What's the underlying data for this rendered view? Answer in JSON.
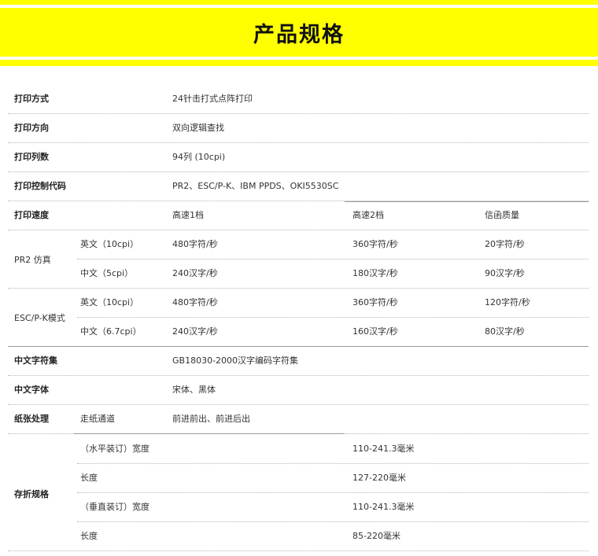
{
  "header": {
    "title": "产品规格"
  },
  "specs": {
    "print_method": {
      "label": "打印方式",
      "value": "24针击打式点阵打印"
    },
    "print_direction": {
      "label": "打印方向",
      "value": "双向逻辑查找"
    },
    "print_columns": {
      "label": "打印列数",
      "value": "94列 (10cpi)"
    },
    "control_codes": {
      "label": "打印控制代码",
      "value": "PR2、ESC/P-K、IBM PPDS、OKI5530SC"
    },
    "print_speed": {
      "label": "打印速度",
      "headers": [
        "高速1档",
        "高速2档",
        "信函质量"
      ],
      "pr2": {
        "group": "PR2 仿真",
        "rows": [
          {
            "label": "英文（10cpi）",
            "values": [
              "480字符/秒",
              "360字符/秒",
              "20字符/秒"
            ]
          },
          {
            "label": "中文（5cpi）",
            "values": [
              "240汉字/秒",
              "180汉字/秒",
              "90汉字/秒"
            ]
          }
        ]
      },
      "escpk": {
        "group": "ESC/P-K模式",
        "rows": [
          {
            "label": "英文（10cpi）",
            "values": [
              "480字符/秒",
              "360字符/秒",
              "120字符/秒"
            ]
          },
          {
            "label": "中文（6.7cpi）",
            "values": [
              "240汉字/秒",
              "160汉字/秒",
              "80汉字/秒"
            ]
          }
        ]
      }
    },
    "charset": {
      "label": "中文字符集",
      "value": "GB18030-2000汉字编码字符集"
    },
    "font": {
      "label": "中文字体",
      "value": "宋体、黑体"
    },
    "paper": {
      "label": "纸张处理",
      "sub_label": "走纸通道",
      "value": "前进前出、前进后出"
    },
    "fanfold": {
      "label": "存折规格",
      "rows": [
        {
          "label": "（水平装订）宽度",
          "value": "110-241.3毫米"
        },
        {
          "label": "长度",
          "value": "127-220毫米"
        },
        {
          "label": "（垂直装订）宽度",
          "value": "110-241.3毫米"
        },
        {
          "label": "长度",
          "value": "85-220毫米"
        }
      ]
    }
  }
}
